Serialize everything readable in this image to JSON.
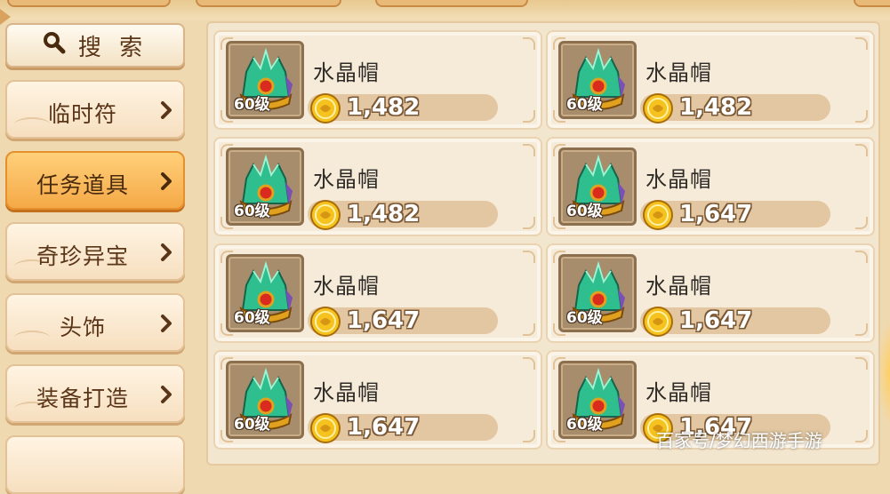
{
  "search": {
    "icon": "search-icon",
    "label": "搜 索"
  },
  "sidebar": {
    "items": [
      {
        "label": "临时符",
        "active": false
      },
      {
        "label": "任务道具",
        "active": true
      },
      {
        "label": "奇珍异宝",
        "active": false
      },
      {
        "label": "头饰",
        "active": false
      },
      {
        "label": "装备打造",
        "active": false
      }
    ]
  },
  "items": [
    {
      "name": "水晶帽",
      "level": "60级",
      "price": "1,482",
      "icon": "crystal-helmet-icon"
    },
    {
      "name": "水晶帽",
      "level": "60级",
      "price": "1,482",
      "icon": "crystal-helmet-icon"
    },
    {
      "name": "水晶帽",
      "level": "60级",
      "price": "1,482",
      "icon": "crystal-helmet-icon"
    },
    {
      "name": "水晶帽",
      "level": "60级",
      "price": "1,647",
      "icon": "crystal-helmet-icon"
    },
    {
      "name": "水晶帽",
      "level": "60级",
      "price": "1,647",
      "icon": "crystal-helmet-icon"
    },
    {
      "name": "水晶帽",
      "level": "60级",
      "price": "1,647",
      "icon": "crystal-helmet-icon"
    },
    {
      "name": "水晶帽",
      "level": "60级",
      "price": "1,647",
      "icon": "crystal-helmet-icon"
    },
    {
      "name": "水晶帽",
      "level": "60级",
      "price": "1,647",
      "icon": "crystal-helmet-icon"
    }
  ],
  "watermark": "百家号/梦幻西游手游",
  "colors": {
    "active_tab": "#f5a947",
    "price_outline": "#7b5734",
    "coin": "#f5c21e"
  }
}
